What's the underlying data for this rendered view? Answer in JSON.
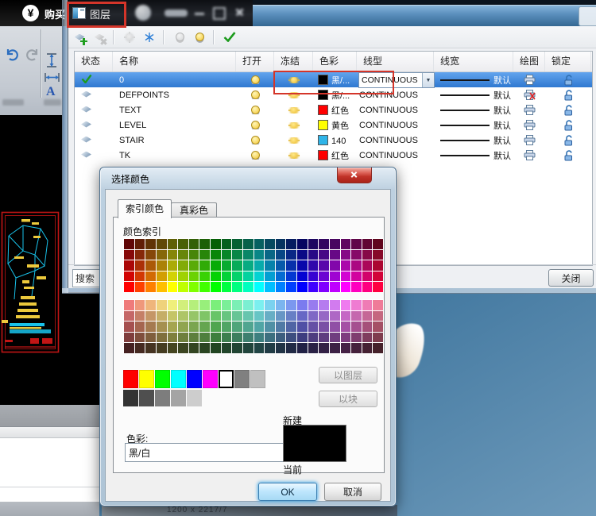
{
  "desktop": {
    "watermark": "1200 x 2217/7",
    "sky_color": "#38699e"
  },
  "app_bar": {
    "currency_badge": "¥",
    "buy_label": "购买",
    "text_tool_glyph": "A"
  },
  "layer_palette": {
    "title": "图层",
    "close_button": "关闭",
    "search_value": "搜索",
    "columns": [
      "状态",
      "名称",
      "打开",
      "冻结",
      "色彩",
      "线型",
      "线宽",
      "绘图",
      "锁定"
    ],
    "rows": [
      {
        "name": "0",
        "current": true,
        "selected": true,
        "color_hex": "#000000",
        "color_name": "黑/...",
        "linetype": "CONTINUOUS",
        "linetype_editing": true,
        "lineweight": "默认",
        "plot": true
      },
      {
        "name": "DEFPOINTS",
        "current": false,
        "selected": false,
        "color_hex": "#000000",
        "color_name": "黑/...",
        "linetype": "CONTINUOUS",
        "linetype_editing": false,
        "lineweight": "默认",
        "plot": false
      },
      {
        "name": "TEXT",
        "current": false,
        "selected": false,
        "color_hex": "#ff0000",
        "color_name": "红色",
        "linetype": "CONTINUOUS",
        "linetype_editing": false,
        "lineweight": "默认",
        "plot": true
      },
      {
        "name": "LEVEL",
        "current": false,
        "selected": false,
        "color_hex": "#ffff00",
        "color_name": "黄色",
        "linetype": "CONTINUOUS",
        "linetype_editing": false,
        "lineweight": "默认",
        "plot": true
      },
      {
        "name": "STAIR",
        "current": false,
        "selected": false,
        "color_hex": "#2fb4e8",
        "color_name": "140",
        "linetype": "CONTINUOUS",
        "linetype_editing": false,
        "lineweight": "默认",
        "plot": true
      },
      {
        "name": "TK",
        "current": false,
        "selected": false,
        "color_hex": "#ff0000",
        "color_name": "红色",
        "linetype": "CONTINUOUS",
        "linetype_editing": false,
        "lineweight": "默认",
        "plot": true
      }
    ]
  },
  "color_dialog": {
    "title": "选择颜色",
    "tabs": [
      "索引颜色",
      "真彩色"
    ],
    "palette_label": "颜色索引",
    "bylayer_button": "以图层",
    "byblock_button": "以块",
    "color_field_label": "色彩:",
    "color_field_value": "黑/白",
    "new_label": "新建",
    "current_label": "当前",
    "ok_button": "OK",
    "cancel_button": "取消",
    "aci": {
      "hues": [
        0,
        15,
        30,
        45,
        60,
        75,
        90,
        105,
        120,
        135,
        150,
        165,
        180,
        195,
        210,
        225,
        240,
        255,
        270,
        285,
        300,
        315,
        330,
        345
      ],
      "bank1": [
        {
          "s": 88,
          "l": 20
        },
        {
          "s": 88,
          "l": 28
        },
        {
          "s": 92,
          "l": 35
        },
        {
          "s": 96,
          "l": 42
        },
        {
          "s": 100,
          "l": 50
        }
      ],
      "bank2": [
        {
          "s": 78,
          "l": 71
        },
        {
          "s": 45,
          "l": 59
        },
        {
          "s": 35,
          "l": 48
        },
        {
          "s": 35,
          "l": 37
        },
        {
          "s": 35,
          "l": 20
        }
      ],
      "standard": [
        "#ff0000",
        "#ffff00",
        "#00ff00",
        "#00ffff",
        "#0000ff",
        "#ff00ff",
        "#ffffff",
        "#808080",
        "#c0c0c0"
      ],
      "selected_standard": 6,
      "grays": [
        "#333333",
        "#4f4f4f",
        "#7d7d7d",
        "#a4a4a4",
        "#cdcdcd"
      ],
      "preview_color": "#000000"
    }
  },
  "annotation": {
    "box_color": "#d4352a"
  }
}
